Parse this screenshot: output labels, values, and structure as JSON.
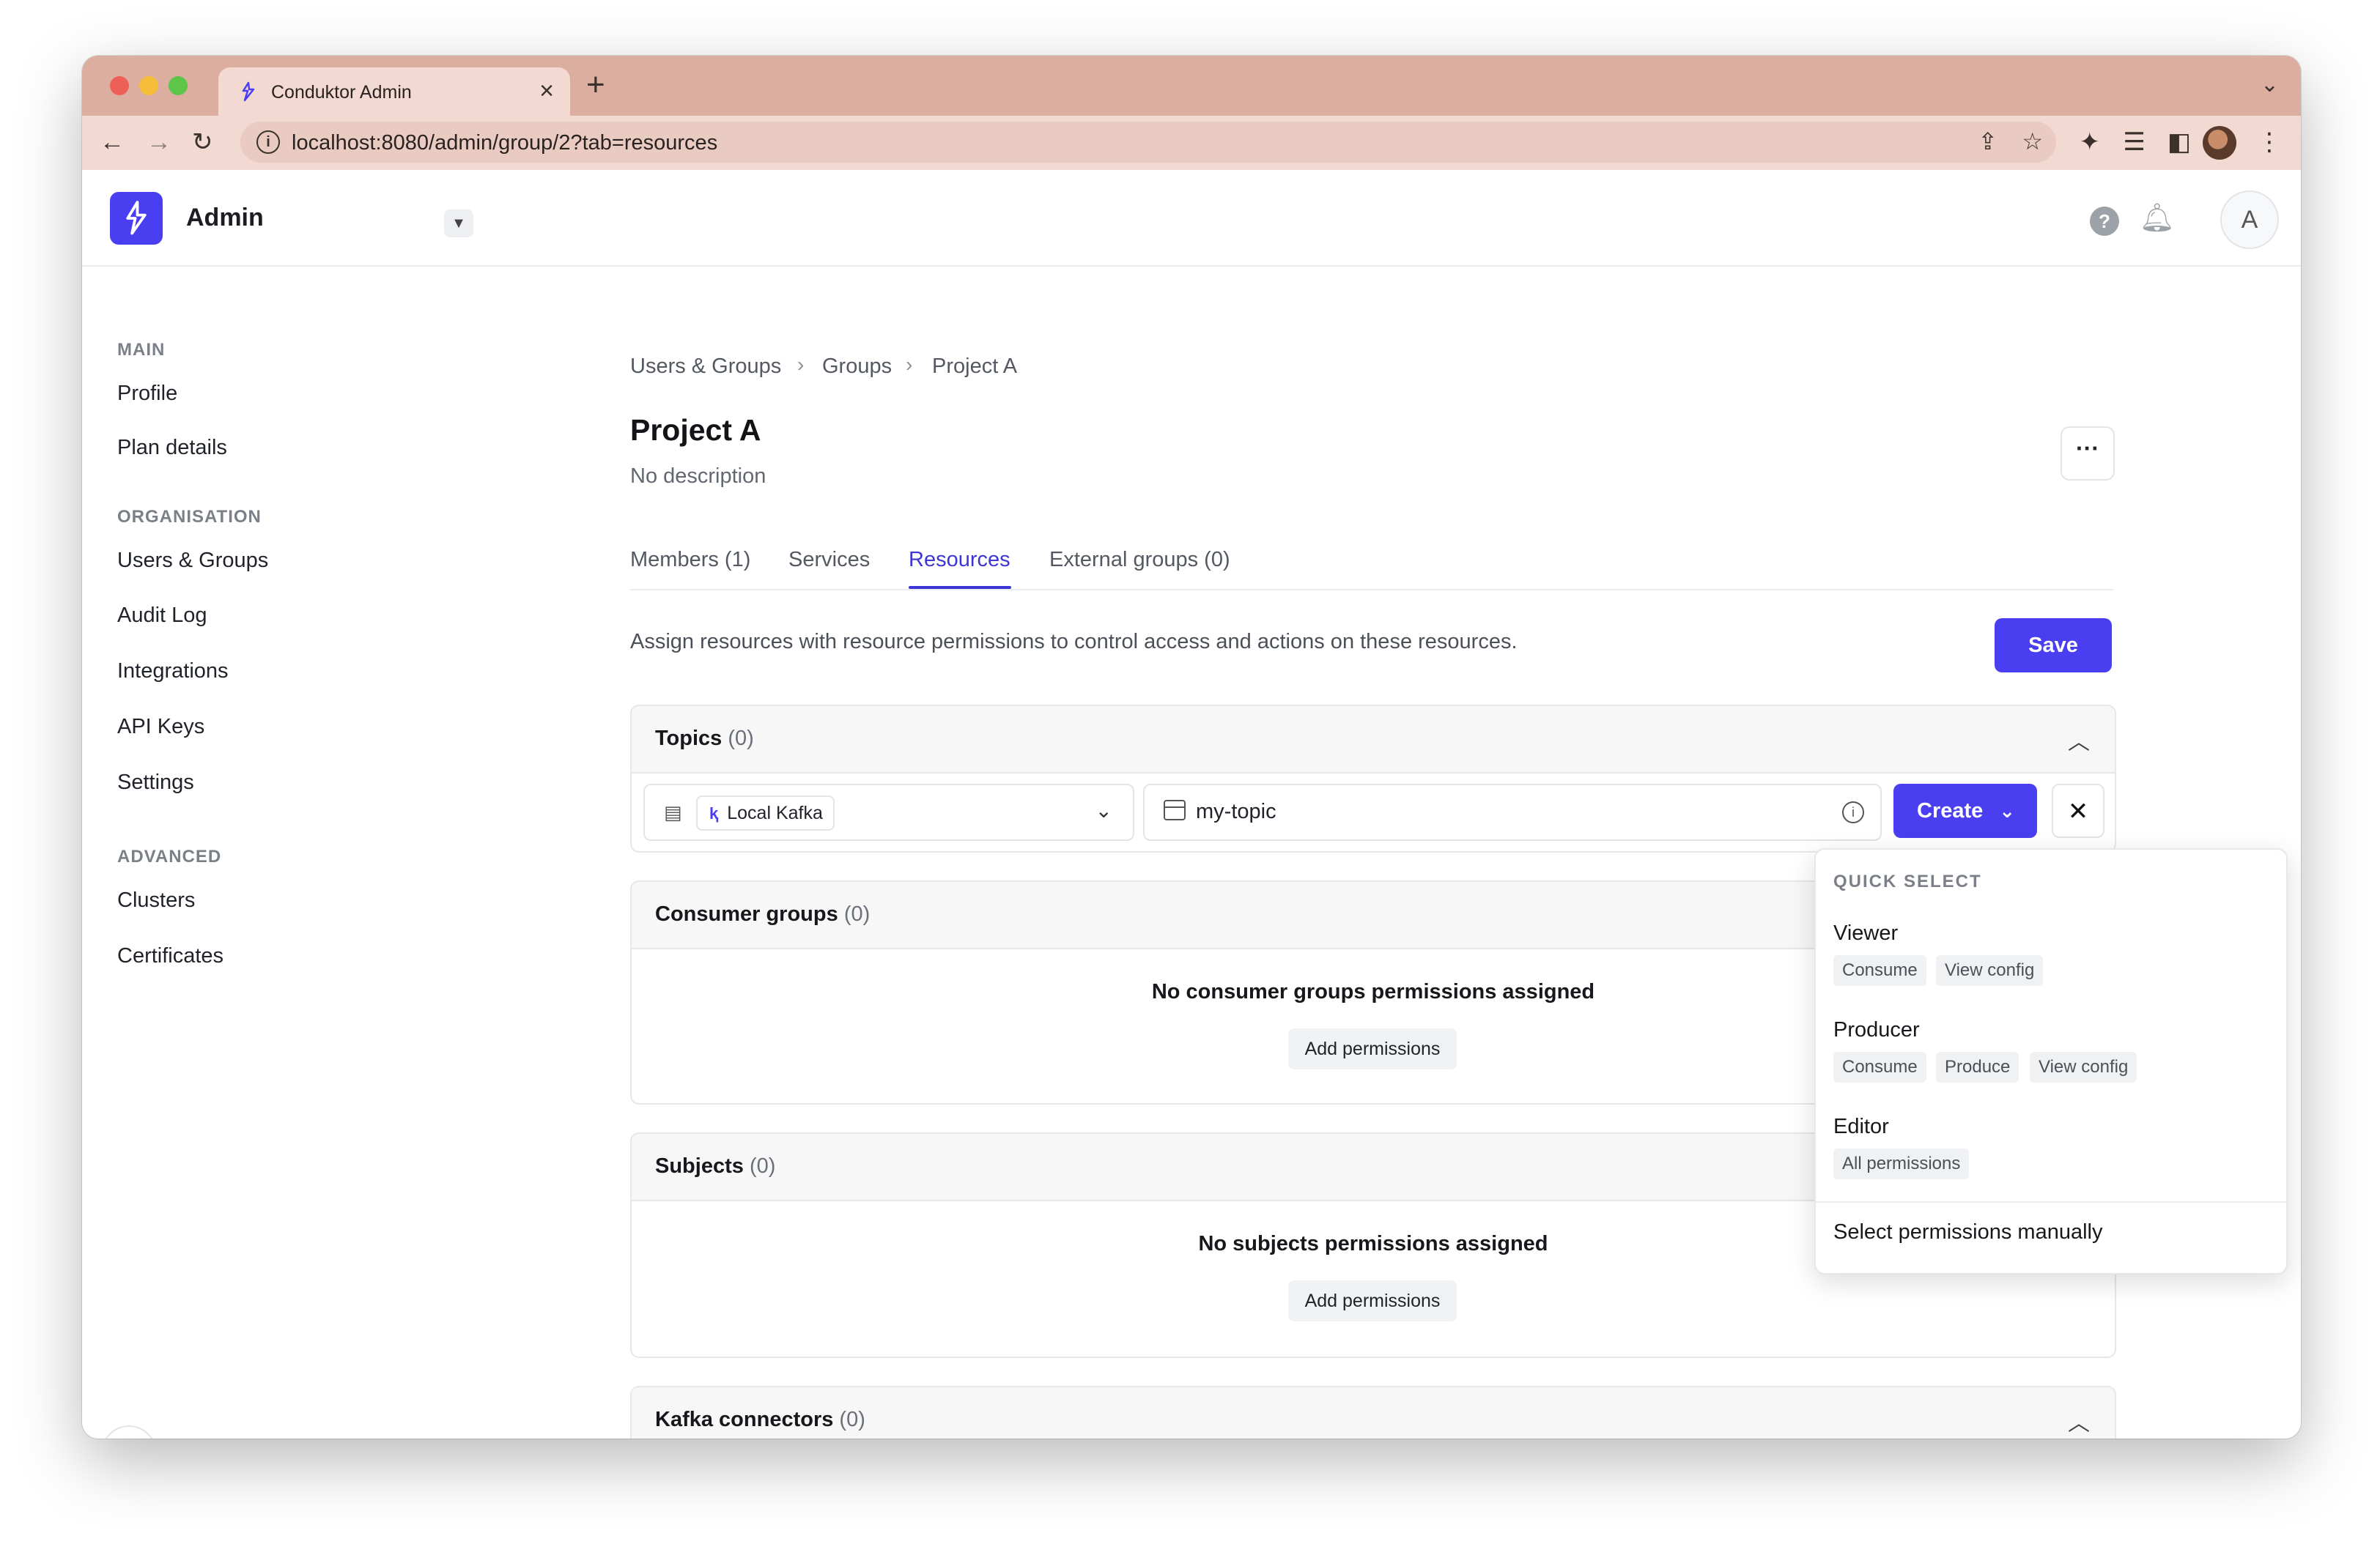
{
  "browser": {
    "tab_title": "Conduktor Admin",
    "url": "localhost:8080/admin/group/2?tab=resources"
  },
  "header": {
    "app_title": "Admin",
    "user_initial": "A"
  },
  "sidebar": {
    "sections": [
      {
        "title": "MAIN",
        "items": [
          "Profile",
          "Plan details"
        ]
      },
      {
        "title": "ORGANISATION",
        "items": [
          "Users & Groups",
          "Audit Log",
          "Integrations",
          "API Keys",
          "Settings"
        ]
      },
      {
        "title": "ADVANCED",
        "items": [
          "Clusters",
          "Certificates"
        ]
      }
    ]
  },
  "main": {
    "breadcrumb": [
      "Users & Groups",
      "Groups",
      "Project A"
    ],
    "title": "Project A",
    "description": "No description",
    "tabs": [
      "Members (1)",
      "Services",
      "Resources",
      "External groups (0)"
    ],
    "active_tab": "Resources",
    "intro": "Assign resources with resource permissions to control access and actions on these resources.",
    "save_label": "Save",
    "topics": {
      "title": "Topics",
      "count": "(0)",
      "cluster": "Local Kafka",
      "topic_value": "my-topic",
      "create_label": "Create"
    },
    "consumer_groups": {
      "title": "Consumer groups",
      "count": "(0)",
      "empty": "No consumer groups permissions assigned",
      "add_label": "Add permissions"
    },
    "subjects": {
      "title": "Subjects",
      "count": "(0)",
      "empty": "No subjects permissions assigned",
      "add_label": "Add permissions"
    },
    "kafka_connectors": {
      "title": "Kafka connectors",
      "count": "(0)"
    }
  },
  "dropdown": {
    "section": "QUICK SELECT",
    "options": [
      {
        "label": "Viewer",
        "chips": [
          "Consume",
          "View config"
        ]
      },
      {
        "label": "Producer",
        "chips": [
          "Consume",
          "Produce",
          "View config"
        ]
      },
      {
        "label": "Editor",
        "chips": [
          "All permissions"
        ]
      }
    ],
    "manual": "Select permissions manually"
  },
  "colors": {
    "accent": "#4a3ff0",
    "titlebar": "#dcaea0",
    "toolbar": "#f2d9d1"
  }
}
